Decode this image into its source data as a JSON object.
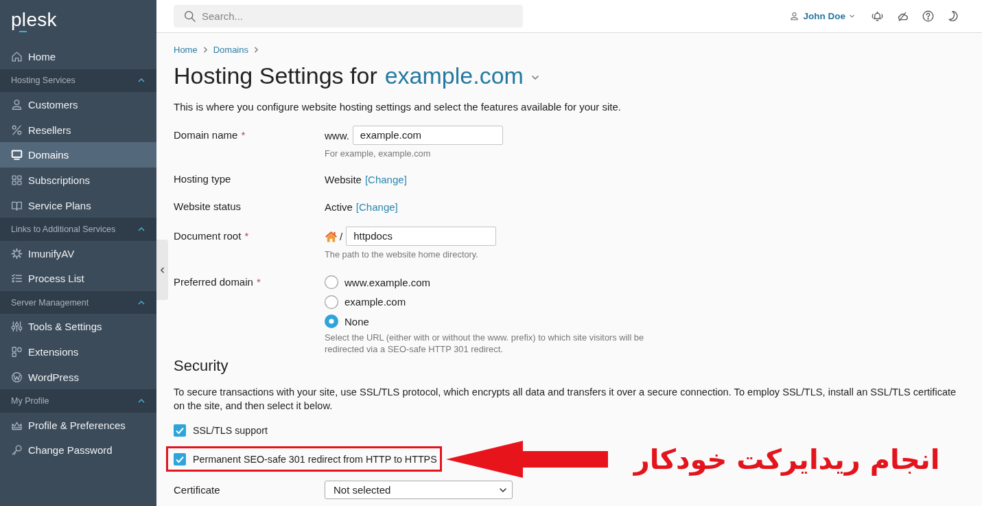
{
  "sidebar": {
    "logo": "plesk",
    "sections": [
      {
        "items": [
          {
            "label": "Home",
            "selected": false
          }
        ]
      },
      {
        "title": "Hosting Services",
        "expanded": true,
        "items": [
          {
            "label": "Customers",
            "selected": false
          },
          {
            "label": "Resellers",
            "selected": false
          },
          {
            "label": "Domains",
            "selected": true
          },
          {
            "label": "Subscriptions",
            "selected": false
          },
          {
            "label": "Service Plans",
            "selected": false
          }
        ]
      },
      {
        "title": "Links to Additional Services",
        "expanded": true,
        "items": [
          {
            "label": "ImunifyAV",
            "selected": false
          },
          {
            "label": "Process List",
            "selected": false
          }
        ]
      },
      {
        "title": "Server Management",
        "expanded": true,
        "items": [
          {
            "label": "Tools & Settings",
            "selected": false
          },
          {
            "label": "Extensions",
            "selected": false
          },
          {
            "label": "WordPress",
            "selected": false
          }
        ]
      },
      {
        "title": "My Profile",
        "expanded": true,
        "items": [
          {
            "label": "Profile & Preferences",
            "selected": false
          },
          {
            "label": "Change Password",
            "selected": false
          }
        ]
      }
    ]
  },
  "top_bar": {
    "search": {
      "placeholder": "Search..."
    },
    "user": "John Doe"
  },
  "breadcrumb": [
    "Home",
    "Domains"
  ],
  "title": {
    "text": "Hosting Settings for",
    "domain": "example.com"
  },
  "description": "This is where you configure website hosting settings and select the features available for your site.",
  "fields": [
    {
      "kind": "input",
      "label": "Domain name",
      "required_mark": "*",
      "prefix": "www.",
      "value": "example.com",
      "hint": "For example, example.com"
    },
    {
      "kind": "text",
      "label": "Hosting type",
      "value": "Website",
      "link": "[Change]"
    },
    {
      "kind": "text",
      "label": "Website status",
      "value": "Active",
      "link": "[Change]"
    },
    {
      "kind": "path_input",
      "label": "Document root",
      "required_mark": "*",
      "prefix": "/",
      "value": "httpdocs",
      "hint": "The path to the website home directory."
    },
    {
      "kind": "radio",
      "label": "Preferred domain",
      "required_mark": "*",
      "options": [
        {
          "label": "www.example.com",
          "selected": false
        },
        {
          "label": "example.com",
          "selected": false
        },
        {
          "label": "None",
          "selected": true
        }
      ],
      "hint": "Select the URL (either with or without the www. prefix) to which site visitors will be redirected via a SEO-safe HTTP 301 redirect."
    }
  ],
  "security": {
    "heading": "Security",
    "text": "To secure transactions with your site, use SSL/TLS protocol, which encrypts all data and transfers it over a secure connection. To employ SSL/TLS, install an SSL/TLS certificate on the site, and then select it below.",
    "checkboxes": [
      {
        "label": "SSL/TLS support",
        "checked": true,
        "highlighted": false
      },
      {
        "label": "Permanent SEO-safe 301 redirect from HTTP to HTTPS",
        "checked": true,
        "highlighted": true
      }
    ],
    "certificate": {
      "label": "Certificate",
      "value": "Not selected"
    }
  },
  "annotation": {
    "text": "انجام ریدایرکت خودکار"
  }
}
